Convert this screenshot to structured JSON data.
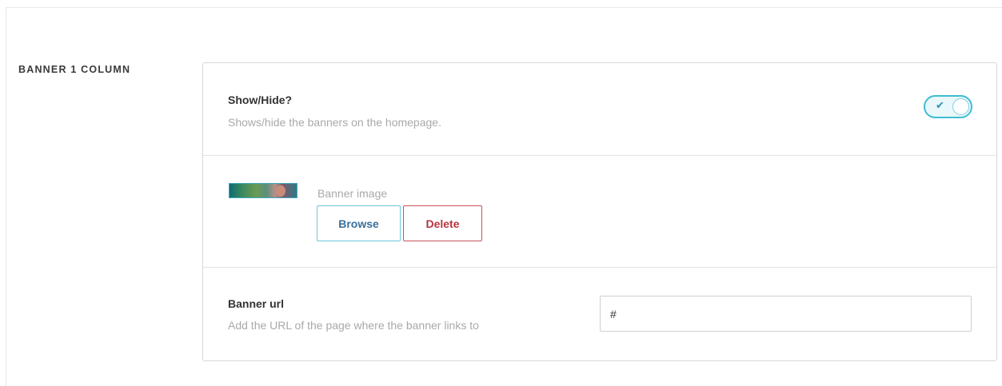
{
  "section": {
    "label": "BANNER 1 COLUMN"
  },
  "show_hide": {
    "title": "Show/Hide?",
    "description": "Shows/hide the banners on the homepage.",
    "toggle_on": true,
    "toggle_icon": "check-icon",
    "toggle_symbol": "✔"
  },
  "banner_image": {
    "label": "Banner image",
    "browse_label": "Browse",
    "delete_label": "Delete"
  },
  "banner_url": {
    "title": "Banner url",
    "description": "Add the URL of the page where the banner links to",
    "value": "#"
  },
  "colors": {
    "accent": "#3fbcd4",
    "browse_text": "#3a6f9a",
    "delete_accent": "#c9525a"
  }
}
